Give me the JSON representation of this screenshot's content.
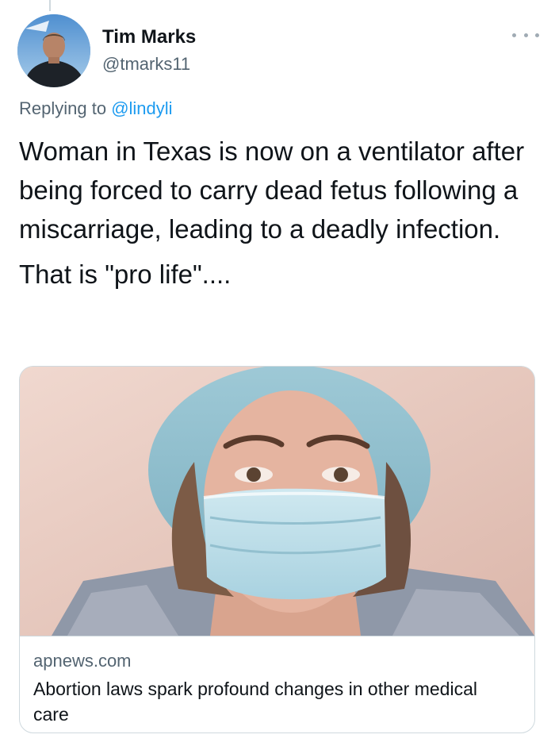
{
  "author": {
    "display_name": "Tim Marks",
    "handle": "@tmarks11"
  },
  "reply": {
    "prefix": "Replying to ",
    "mention": "@lindyli"
  },
  "tweet": {
    "text_line_1": "Woman in Texas is now on a ventilator after being forced to carry dead fetus following a miscarriage, leading to a deadly infection.",
    "text_line_2": "That is \"pro life\"...."
  },
  "link_card": {
    "domain": "apnews.com",
    "title": "Abortion laws spark profound changes in other medical care"
  },
  "icons": {
    "more": "more-options-icon",
    "avatar": "avatar-photo"
  },
  "colors": {
    "text_primary": "#0f1419",
    "text_secondary": "#536471",
    "link": "#1d9bf0",
    "border": "#cfd9de"
  }
}
